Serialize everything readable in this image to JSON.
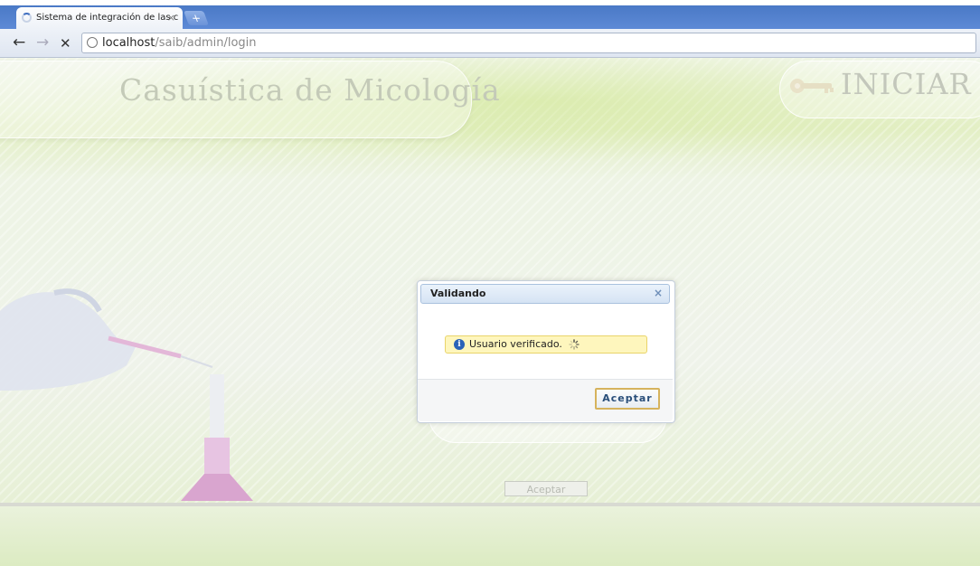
{
  "browser": {
    "tab_title": "Sistema de integración de las c",
    "tab_close": "×",
    "new_tab": "+",
    "url_host": "localhost",
    "url_path": "/saib/admin/login",
    "back": "←",
    "forward": "→",
    "stop": "✕"
  },
  "page": {
    "site_title": "Casuística de Micología",
    "iniciar_label": "INICIAR",
    "bg_accept_label": "Aceptar"
  },
  "modal": {
    "title": "Validando",
    "close": "×",
    "message": "Usuario verificado.",
    "accept_label": "Aceptar"
  },
  "colors": {
    "modal_header": "#d5e3f4",
    "notice_bg": "#fef6bd",
    "notice_border": "#e9d46a",
    "button_border": "#d6b35d",
    "tabbar": "#4a79c6"
  },
  "icons": [
    "spinner-icon",
    "globe-icon",
    "key-icon",
    "info-icon",
    "loader-icon",
    "close-icon"
  ]
}
